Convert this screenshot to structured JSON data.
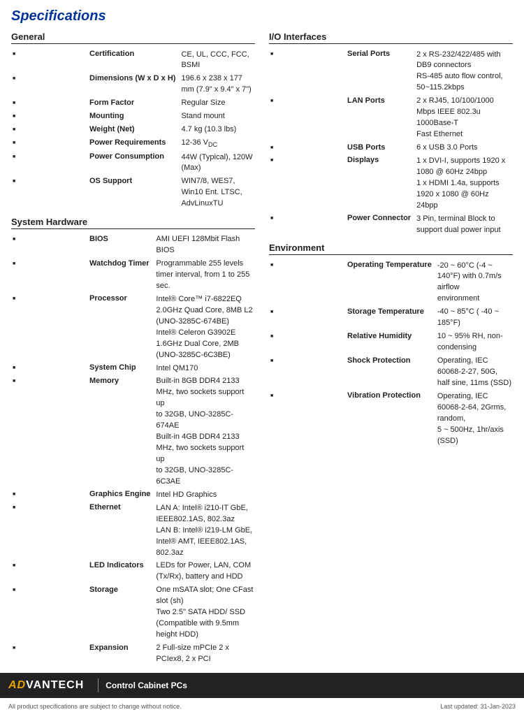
{
  "page": {
    "title": "Specifications"
  },
  "footer": {
    "brand_adv": "AD",
    "brand_vantech": "VANTECH",
    "brand_full": "ADVANTECH",
    "subtitle": "Control Cabinet PCs",
    "note_left": "All product specifications are subject to change without notice.",
    "note_right": "Last updated: 31-Jan-2023"
  },
  "sections": {
    "general": {
      "title": "General",
      "rows": [
        {
          "label": "Certification",
          "value": "CE, UL, CCC, FCC, BSMI"
        },
        {
          "label": "Dimensions (W x D x H)",
          "value": "196.6 x 238 x 177 mm (7.9\" x 9.4\" x 7\")"
        },
        {
          "label": "Form Factor",
          "value": "Regular Size"
        },
        {
          "label": "Mounting",
          "value": "Stand mount"
        },
        {
          "label": "Weight (Net)",
          "value": "4.7 kg (10.3 lbs)"
        },
        {
          "label": "Power Requirements",
          "value": "12-36 VDC"
        },
        {
          "label": "Power Consumption",
          "value": "44W (Typical), 120W (Max)"
        },
        {
          "label": "OS Support",
          "value": "WIN7/8, WES7, Win10 Ent. LTSC, AdvLinuxTU"
        }
      ]
    },
    "system_hardware": {
      "title": "System Hardware",
      "rows": [
        {
          "label": "BIOS",
          "value": "AMI UEFI 128Mbit Flash BIOS"
        },
        {
          "label": "Watchdog Timer",
          "value": "Programmable 255 levels timer interval, from 1 to 255 sec."
        },
        {
          "label": "Processor",
          "value": "Intel® Core™ i7-6822EQ 2.0GHz Quad Core, 8MB L2\n(UNO-3285C-674BE)\nIntel® Celeron G3902E 1.6GHz Dual Core, 2MB\n(UNO-3285C-6C3BE)"
        },
        {
          "label": "System Chip",
          "value": "Intel QM170"
        },
        {
          "label": "Memory",
          "value": "Built-in 8GB DDR4 2133 MHz, two sockets support up\nto 32GB, UNO-3285C-674AE\nBuilt-in 4GB DDR4 2133 MHz, two sockets support up\nto 32GB, UNO-3285C-6C3AE"
        },
        {
          "label": "Graphics Engine",
          "value": "Intel HD Graphics"
        },
        {
          "label": "Ethernet",
          "value": "LAN A: Intel® i210-IT GbE, IEEE802.1AS, 802.3az\nLAN B: Intel® i219-LM GbE, Intel® AMT, IEEE802.1AS, 802.3az"
        },
        {
          "label": "LED Indicators",
          "value": "LEDs for Power, LAN, COM (Tx/Rx), battery and HDD"
        },
        {
          "label": "Storage",
          "value": "One mSATA slot; One CFast slot (sh)\nTwo 2.5\" SATA HDD/ SSD (Compatible with 9.5mm height HDD)"
        },
        {
          "label": "Expansion",
          "value": "2 Full-size mPCIe 2 x PCIex8, 2 x PCI"
        }
      ]
    },
    "io_interfaces": {
      "title": "I/O Interfaces",
      "rows": [
        {
          "label": "Serial Ports",
          "value": "2 x RS-232/422/485 with DB9 connectors\nRS-485 auto flow control, 50~115.2kbps"
        },
        {
          "label": "LAN Ports",
          "value": "2 x RJ45, 10/100/1000 Mbps IEEE 802.3u 1000Base-T\nFast Ethernet"
        },
        {
          "label": "USB Ports",
          "value": "6 x USB 3.0 Ports"
        },
        {
          "label": "Displays",
          "value": "1 x DVI-I, supports 1920 x 1080 @ 60Hz 24bpp\n1 x HDMI 1.4a, supports 1920 x 1080 @ 60Hz 24bpp"
        },
        {
          "label": "Power Connector",
          "value": "3 Pin, terminal Block to support dual power input"
        }
      ]
    },
    "environment": {
      "title": "Environment",
      "rows": [
        {
          "label": "Operating Temperature",
          "value": "-20 ~ 60°C (-4 ~ 140°F) with 0.7m/s airflow\nenvironment"
        },
        {
          "label": "Storage Temperature",
          "value": "-40 ~ 85°C ( -40 ~ 185°F)"
        },
        {
          "label": "Relative Humidity",
          "value": "10 ~ 95% RH, non-condensing"
        },
        {
          "label": "Shock Protection",
          "value": "Operating, IEC 60068-2-27, 50G, half sine, 11ms (SSD)"
        },
        {
          "label": "Vibration Protection",
          "value": "Operating, IEC 60068-2-64, 2Grms, random,\n5 ~ 500Hz, 1hr/axis (SSD)"
        }
      ]
    }
  }
}
